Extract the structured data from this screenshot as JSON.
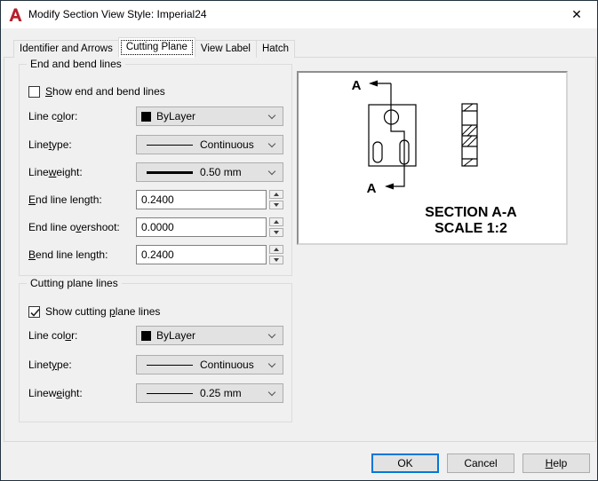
{
  "window": {
    "title": "Modify Section View Style: Imperial24",
    "close_glyph": "✕",
    "accent_color": "#0078d7"
  },
  "tabs": [
    {
      "label": "Identifier and Arrows"
    },
    {
      "label": "Cutting Plane"
    },
    {
      "label": "View Label"
    },
    {
      "label": "Hatch"
    }
  ],
  "selected_tab": "Cutting Plane",
  "end_bend_group": {
    "title": "End and bend lines",
    "show_checkbox": {
      "checked": false,
      "label_pre": "",
      "label_key": "S",
      "label_post": "how end and bend lines"
    },
    "line_color": {
      "label_pre": "Line c",
      "label_key": "o",
      "label_post": "lor:",
      "value": "ByLayer",
      "swatch_color": "#000000"
    },
    "linetype": {
      "label_pre": "Line",
      "label_key": "t",
      "label_post": "ype:",
      "value": "Continuous"
    },
    "lineweight": {
      "label_pre": "Line",
      "label_key": "w",
      "label_post": "eight:",
      "value": "0.50 mm"
    },
    "end_line_length": {
      "label_pre": "",
      "label_key": "E",
      "label_post": "nd line length:",
      "value": "0.2400"
    },
    "end_line_overshoot": {
      "label_pre": "End line o",
      "label_key": "v",
      "label_post": "ershoot:",
      "value": "0.0000"
    },
    "bend_line_length": {
      "label_pre": "",
      "label_key": "B",
      "label_post": "end line length:",
      "value": "0.2400"
    }
  },
  "cutting_group": {
    "title": "Cutting plane lines",
    "show_checkbox": {
      "checked": true,
      "label_pre": "Show cutting ",
      "label_key": "p",
      "label_post": "lane lines"
    },
    "line_color": {
      "label_pre": "Line col",
      "label_key": "o",
      "label_post": "r:",
      "value": "ByLayer",
      "swatch_color": "#000000"
    },
    "linetype": {
      "label_pre": "Linet",
      "label_key": "y",
      "label_post": "pe:",
      "value": "Continuous"
    },
    "lineweight": {
      "label_pre": "Linew",
      "label_key": "e",
      "label_post": "ight:",
      "value": "0.25 mm"
    }
  },
  "preview": {
    "cut_letter": "A",
    "section_text": "SECTION A-A",
    "scale_text": "SCALE 1:2"
  },
  "action_buttons": {
    "ok": "OK",
    "cancel": "Cancel",
    "help_pre": "",
    "help_key": "H",
    "help_post": "elp"
  }
}
